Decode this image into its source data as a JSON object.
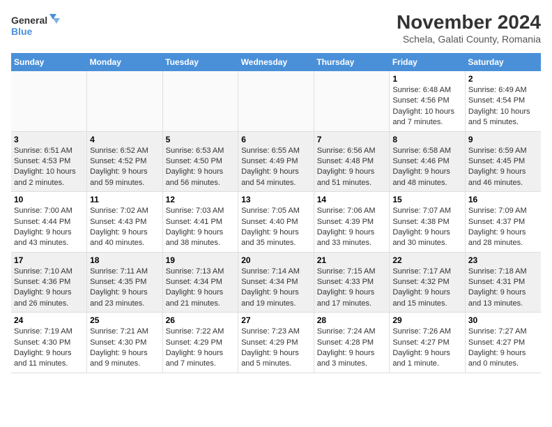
{
  "logo": {
    "line1": "General",
    "line2": "Blue"
  },
  "title": "November 2024",
  "subtitle": "Schela, Galati County, Romania",
  "days_of_week": [
    "Sunday",
    "Monday",
    "Tuesday",
    "Wednesday",
    "Thursday",
    "Friday",
    "Saturday"
  ],
  "weeks": [
    [
      {
        "day": "",
        "info": ""
      },
      {
        "day": "",
        "info": ""
      },
      {
        "day": "",
        "info": ""
      },
      {
        "day": "",
        "info": ""
      },
      {
        "day": "",
        "info": ""
      },
      {
        "day": "1",
        "info": "Sunrise: 6:48 AM\nSunset: 4:56 PM\nDaylight: 10 hours and 7 minutes."
      },
      {
        "day": "2",
        "info": "Sunrise: 6:49 AM\nSunset: 4:54 PM\nDaylight: 10 hours and 5 minutes."
      }
    ],
    [
      {
        "day": "3",
        "info": "Sunrise: 6:51 AM\nSunset: 4:53 PM\nDaylight: 10 hours and 2 minutes."
      },
      {
        "day": "4",
        "info": "Sunrise: 6:52 AM\nSunset: 4:52 PM\nDaylight: 9 hours and 59 minutes."
      },
      {
        "day": "5",
        "info": "Sunrise: 6:53 AM\nSunset: 4:50 PM\nDaylight: 9 hours and 56 minutes."
      },
      {
        "day": "6",
        "info": "Sunrise: 6:55 AM\nSunset: 4:49 PM\nDaylight: 9 hours and 54 minutes."
      },
      {
        "day": "7",
        "info": "Sunrise: 6:56 AM\nSunset: 4:48 PM\nDaylight: 9 hours and 51 minutes."
      },
      {
        "day": "8",
        "info": "Sunrise: 6:58 AM\nSunset: 4:46 PM\nDaylight: 9 hours and 48 minutes."
      },
      {
        "day": "9",
        "info": "Sunrise: 6:59 AM\nSunset: 4:45 PM\nDaylight: 9 hours and 46 minutes."
      }
    ],
    [
      {
        "day": "10",
        "info": "Sunrise: 7:00 AM\nSunset: 4:44 PM\nDaylight: 9 hours and 43 minutes."
      },
      {
        "day": "11",
        "info": "Sunrise: 7:02 AM\nSunset: 4:43 PM\nDaylight: 9 hours and 40 minutes."
      },
      {
        "day": "12",
        "info": "Sunrise: 7:03 AM\nSunset: 4:41 PM\nDaylight: 9 hours and 38 minutes."
      },
      {
        "day": "13",
        "info": "Sunrise: 7:05 AM\nSunset: 4:40 PM\nDaylight: 9 hours and 35 minutes."
      },
      {
        "day": "14",
        "info": "Sunrise: 7:06 AM\nSunset: 4:39 PM\nDaylight: 9 hours and 33 minutes."
      },
      {
        "day": "15",
        "info": "Sunrise: 7:07 AM\nSunset: 4:38 PM\nDaylight: 9 hours and 30 minutes."
      },
      {
        "day": "16",
        "info": "Sunrise: 7:09 AM\nSunset: 4:37 PM\nDaylight: 9 hours and 28 minutes."
      }
    ],
    [
      {
        "day": "17",
        "info": "Sunrise: 7:10 AM\nSunset: 4:36 PM\nDaylight: 9 hours and 26 minutes."
      },
      {
        "day": "18",
        "info": "Sunrise: 7:11 AM\nSunset: 4:35 PM\nDaylight: 9 hours and 23 minutes."
      },
      {
        "day": "19",
        "info": "Sunrise: 7:13 AM\nSunset: 4:34 PM\nDaylight: 9 hours and 21 minutes."
      },
      {
        "day": "20",
        "info": "Sunrise: 7:14 AM\nSunset: 4:34 PM\nDaylight: 9 hours and 19 minutes."
      },
      {
        "day": "21",
        "info": "Sunrise: 7:15 AM\nSunset: 4:33 PM\nDaylight: 9 hours and 17 minutes."
      },
      {
        "day": "22",
        "info": "Sunrise: 7:17 AM\nSunset: 4:32 PM\nDaylight: 9 hours and 15 minutes."
      },
      {
        "day": "23",
        "info": "Sunrise: 7:18 AM\nSunset: 4:31 PM\nDaylight: 9 hours and 13 minutes."
      }
    ],
    [
      {
        "day": "24",
        "info": "Sunrise: 7:19 AM\nSunset: 4:30 PM\nDaylight: 9 hours and 11 minutes."
      },
      {
        "day": "25",
        "info": "Sunrise: 7:21 AM\nSunset: 4:30 PM\nDaylight: 9 hours and 9 minutes."
      },
      {
        "day": "26",
        "info": "Sunrise: 7:22 AM\nSunset: 4:29 PM\nDaylight: 9 hours and 7 minutes."
      },
      {
        "day": "27",
        "info": "Sunrise: 7:23 AM\nSunset: 4:29 PM\nDaylight: 9 hours and 5 minutes."
      },
      {
        "day": "28",
        "info": "Sunrise: 7:24 AM\nSunset: 4:28 PM\nDaylight: 9 hours and 3 minutes."
      },
      {
        "day": "29",
        "info": "Sunrise: 7:26 AM\nSunset: 4:27 PM\nDaylight: 9 hours and 1 minute."
      },
      {
        "day": "30",
        "info": "Sunrise: 7:27 AM\nSunset: 4:27 PM\nDaylight: 9 hours and 0 minutes."
      }
    ]
  ],
  "colors": {
    "header_bg": "#4a90d9",
    "header_text": "#ffffff",
    "row_odd": "#f0f0f0",
    "row_even": "#ffffff"
  }
}
